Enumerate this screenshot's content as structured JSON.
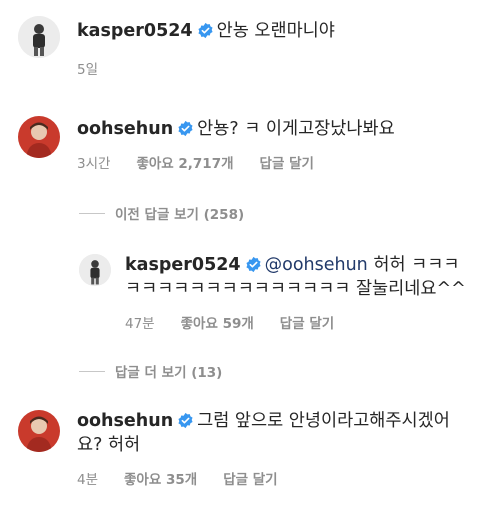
{
  "comments": [
    {
      "username": "kasper0524",
      "text": "안농 오랜마니야",
      "time": "5일",
      "likes": "",
      "reply": ""
    },
    {
      "username": "oohsehun",
      "text": "안뇽? ㅋ 이게고장났나봐요",
      "time": "3시간",
      "likes": "좋아요 2,717개",
      "reply": "답글 달기"
    },
    {
      "username": "kasper0524",
      "mention": "@oohsehun",
      "text_line1": "허허 ㅋㅋㅋ",
      "text_line2": "ㅋㅋㅋㅋㅋㅋㅋㅋㅋㅋㅋㅋㅋㅋ 잘눌리네요^^",
      "time": "47분",
      "likes": "좋아요 59개",
      "reply": "답글 달기"
    },
    {
      "username": "oohsehun",
      "text_line1": "그럼 앞으로 안녕이라고해주시겠어",
      "text_line2": "요? 허허",
      "time": "4분",
      "likes": "좋아요 35개",
      "reply": "답글 달기"
    }
  ],
  "toggles": {
    "previous_replies": "이전 답글 보기 (258)",
    "more_replies": "답글 더 보기 (13)"
  },
  "colors": {
    "verified": "#3897f0",
    "meta": "#8e8e8e",
    "mention": "#223a6a"
  }
}
